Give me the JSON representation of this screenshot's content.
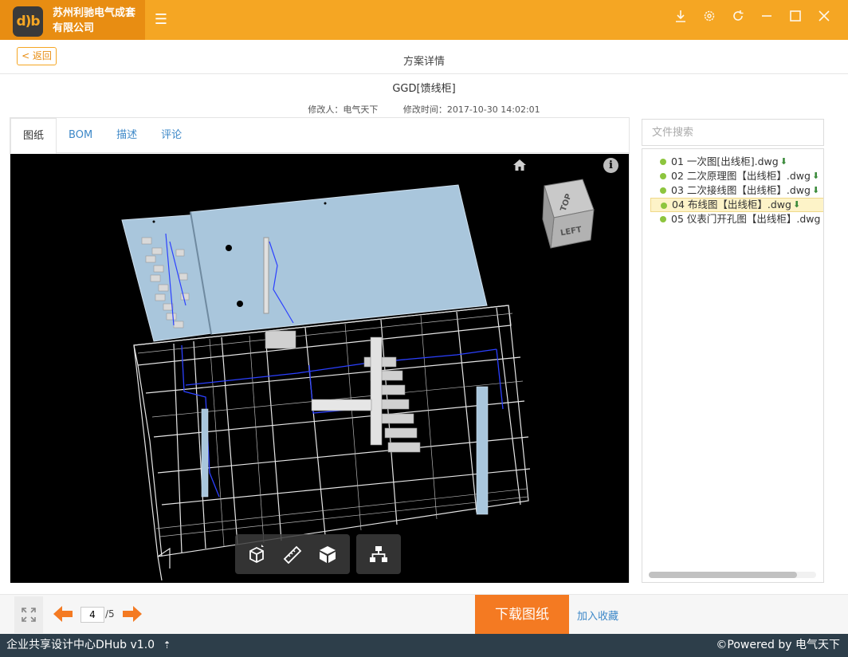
{
  "app": {
    "logo_text": "d)b",
    "company_name": "苏州利驰电气成套有限公司",
    "menu_icon": "hamburger-icon",
    "window_controls": [
      "download-icon",
      "gear-icon",
      "refresh-icon",
      "minimize-icon",
      "maximize-icon",
      "close-icon"
    ]
  },
  "header": {
    "back_label": "< 返回",
    "page_title": "方案详情",
    "scheme_name": "GGD[馈线柜]",
    "modifier_label": "修改人：电气天下",
    "modified_time_label": "修改时间：2017-10-30 14:02:01"
  },
  "tabs": [
    {
      "label": "图纸",
      "active": true
    },
    {
      "label": "BOM",
      "active": false
    },
    {
      "label": "描述",
      "active": false
    },
    {
      "label": "评论",
      "active": false
    }
  ],
  "viewer": {
    "viewcube_top": "TOP",
    "viewcube_left": "LEFT",
    "toolbar_icons": [
      "model-view-icon",
      "ruler-icon",
      "cube-icon",
      "structure-tree-icon"
    ]
  },
  "file_panel": {
    "search_placeholder": "文件搜索",
    "files": [
      {
        "label": "01 一次图[出线柜].dwg",
        "selected": false
      },
      {
        "label": "02 二次原理图【出线柜】.dwg",
        "selected": false
      },
      {
        "label": "03 二次接线图【出线柜】.dwg",
        "selected": false
      },
      {
        "label": "04 布线图【出线柜】.dwg",
        "selected": true
      },
      {
        "label": "05 仪表门开孔图【出线柜】.dwg",
        "selected": false
      }
    ]
  },
  "pagination": {
    "current": "4",
    "total_label": "/5"
  },
  "actions": {
    "download_label": "下载图纸",
    "favorite_label": "加入收藏"
  },
  "status": {
    "left_text": "企业共享设计中心DHub v1.0",
    "right_text": "©Powered by 电气天下"
  },
  "colors": {
    "brand_orange": "#f5a623",
    "brand_dark_orange": "#e88d12",
    "download_orange": "#f47a22",
    "link_blue": "#3d88c8",
    "status_bar": "#2d3e4a"
  }
}
